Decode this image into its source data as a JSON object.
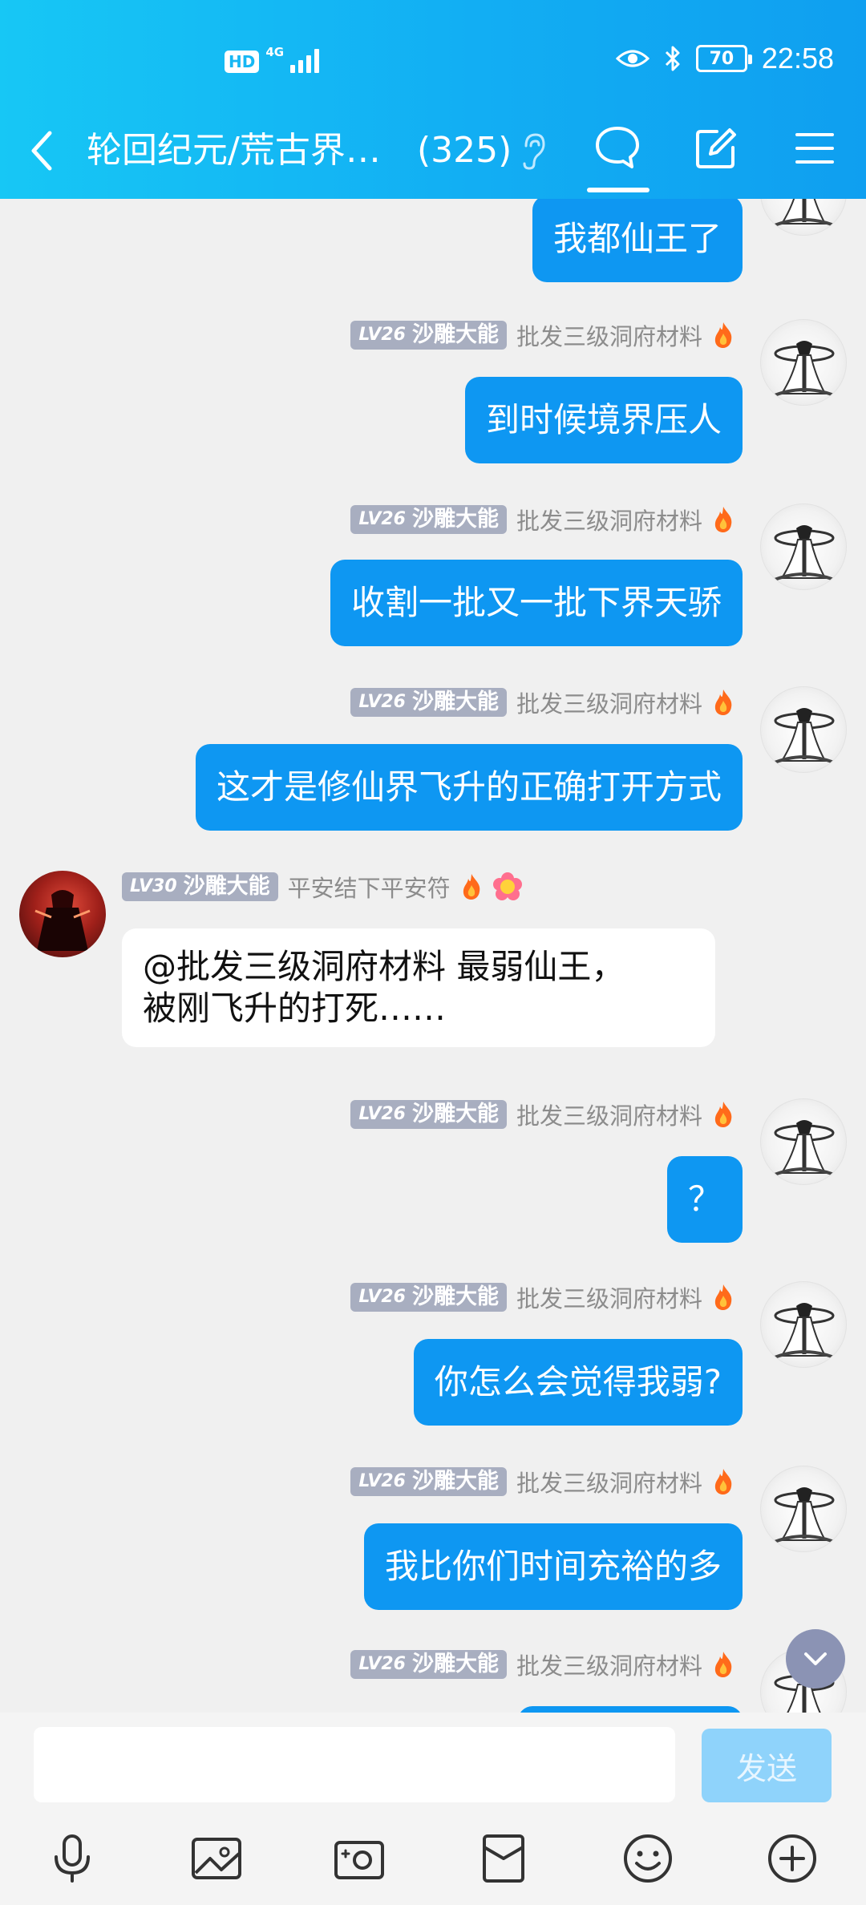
{
  "status_bar": {
    "hd": "HD",
    "network": "4G",
    "battery": "70",
    "time": "22:58"
  },
  "nav": {
    "title": "轮回纪元/荒古界…",
    "member_count": "(325)"
  },
  "messages": [
    {
      "side": "right",
      "text": "我都仙王了"
    },
    {
      "side": "right",
      "level": "LV26",
      "rank": "沙雕大能",
      "sender": "批发三级洞府材料",
      "text": "到时候境界压人"
    },
    {
      "side": "right",
      "level": "LV26",
      "rank": "沙雕大能",
      "sender": "批发三级洞府材料",
      "text": "收割一批又一批下界天骄"
    },
    {
      "side": "right",
      "level": "LV26",
      "rank": "沙雕大能",
      "sender": "批发三级洞府材料",
      "text": "这才是修仙界飞升的正确打开方式"
    },
    {
      "side": "left",
      "level": "LV30",
      "rank": "沙雕大能",
      "sender": "平安结下平安符",
      "text_line1": "@批发三级洞府材料 最弱仙王，",
      "text_line2": "被刚飞升的打死……"
    },
    {
      "side": "right",
      "level": "LV26",
      "rank": "沙雕大能",
      "sender": "批发三级洞府材料",
      "text": "？"
    },
    {
      "side": "right",
      "level": "LV26",
      "rank": "沙雕大能",
      "sender": "批发三级洞府材料",
      "text": "你怎么会觉得我弱?"
    },
    {
      "side": "right",
      "level": "LV26",
      "rank": "沙雕大能",
      "sender": "批发三级洞府材料",
      "text": "我比你们时间充裕的多"
    },
    {
      "side": "right",
      "level": "LV26",
      "rank": "沙雕大能",
      "sender": "批发三级洞府材料"
    }
  ],
  "input": {
    "placeholder": "",
    "send_label": "发送"
  },
  "toolbar_icons": [
    "microphone-icon",
    "image-icon",
    "camera-icon",
    "red-packet-icon",
    "emoji-icon",
    "plus-icon"
  ],
  "colors": {
    "header": "#12aef3",
    "bubble_self": "#0e97f2",
    "bubble_other": "#ffffff",
    "send_disabled": "#8fd3fb",
    "level_badge": "#a8aec0"
  }
}
